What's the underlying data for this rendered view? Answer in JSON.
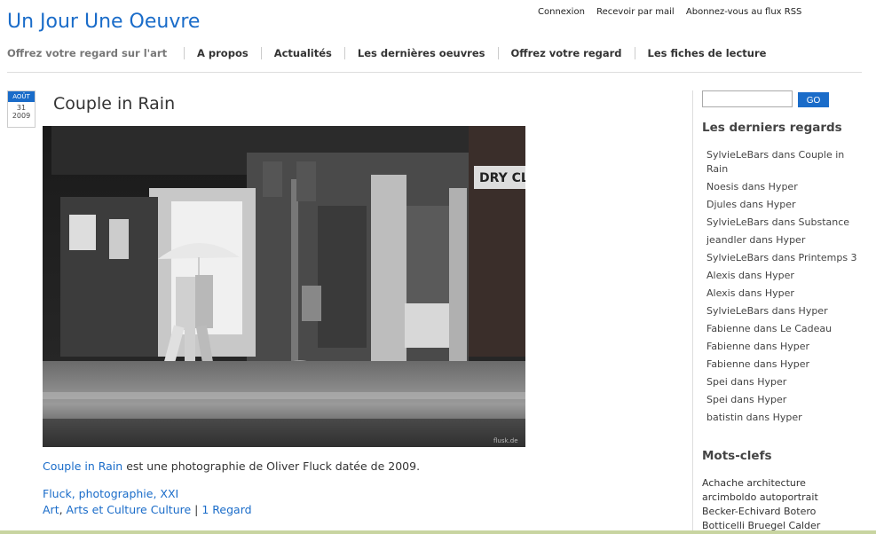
{
  "site": {
    "title": "Un Jour Une Oeuvre",
    "tagline": "Offrez votre regard sur l'art"
  },
  "top_links": [
    "Connexion",
    "Recevoir par mail",
    "Abonnez-vous au flux RSS"
  ],
  "nav": [
    "A propos",
    "Actualités",
    "Les dernières oeuvres",
    "Offrez votre regard",
    "Les fiches de lecture"
  ],
  "post": {
    "date": {
      "month": "AOÛT",
      "day": "31",
      "year": "2009"
    },
    "title": "Couple in Rain",
    "photo_credit": "flusk.de",
    "caption_link": "Couple in Rain",
    "caption_rest": " est une photographie de Oliver Fluck datée de 2009.",
    "tags": [
      "Fluck",
      "photographie",
      "XXI"
    ],
    "categories": [
      "Art",
      "Arts et Culture",
      "Culture"
    ],
    "comments": "1 Regard"
  },
  "sidebar": {
    "search_button": "GO",
    "recent_heading": "Les derniers regards",
    "recent": [
      "SylvieLeBars dans Couple in Rain",
      "Noesis dans Hyper",
      "Djules dans Hyper",
      "SylvieLeBars dans Substance",
      "jeandler dans Hyper",
      "SylvieLeBars dans Printemps 3",
      "Alexis dans Hyper",
      "Alexis dans Hyper",
      "SylvieLeBars dans Hyper",
      "Fabienne dans Le Cadeau",
      "Fabienne dans Hyper",
      "Fabienne dans Hyper",
      "Spei dans Hyper",
      "Spei dans Hyper",
      "batistin dans Hyper"
    ],
    "keywords_heading": "Mots-clefs",
    "keywords": "Achache architecture arcimboldo autoportrait Becker-Echivard Botero Botticelli Bruegel Calder"
  }
}
